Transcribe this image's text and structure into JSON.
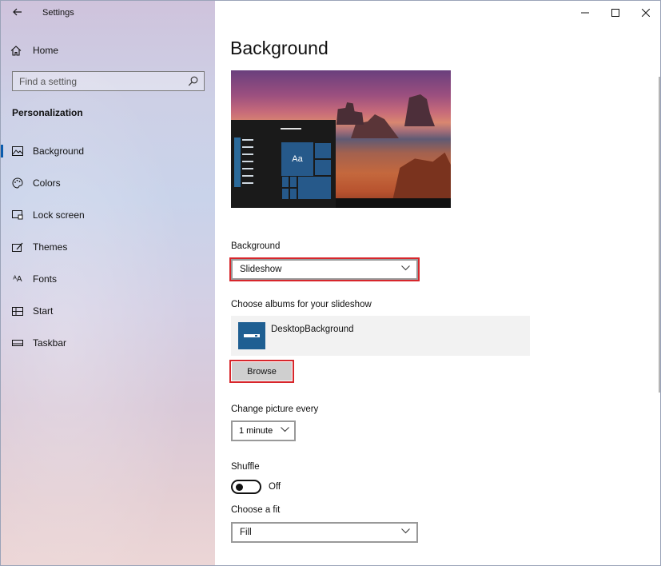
{
  "window": {
    "app_title": "Settings",
    "controls": {
      "minimize": "–",
      "maximize": "☐",
      "close": "✕"
    }
  },
  "sidebar": {
    "home_label": "Home",
    "search_placeholder": "Find a setting",
    "section_title": "Personalization",
    "items": [
      {
        "label": "Background",
        "icon": "picture-icon",
        "active": true
      },
      {
        "label": "Colors",
        "icon": "palette-icon",
        "active": false
      },
      {
        "label": "Lock screen",
        "icon": "lock-screen-icon",
        "active": false
      },
      {
        "label": "Themes",
        "icon": "themes-icon",
        "active": false
      },
      {
        "label": "Fonts",
        "icon": "fonts-icon",
        "active": false
      },
      {
        "label": "Start",
        "icon": "start-icon",
        "active": false
      },
      {
        "label": "Taskbar",
        "icon": "taskbar-icon",
        "active": false
      }
    ]
  },
  "main": {
    "page_title": "Background",
    "preview": {
      "tile_text": "Aa"
    },
    "background": {
      "label": "Background",
      "value": "Slideshow"
    },
    "albums": {
      "label": "Choose albums for your slideshow",
      "album_name": "DesktopBackground",
      "browse_label": "Browse"
    },
    "change_picture": {
      "label": "Change picture every",
      "value": "1 minute"
    },
    "shuffle": {
      "label": "Shuffle",
      "state_label": "Off",
      "on": false
    },
    "fit": {
      "label": "Choose a fit",
      "value": "Fill"
    }
  },
  "colors": {
    "accent": "#0b5cad",
    "highlight": "#d7262b",
    "tile": "#26598a"
  }
}
